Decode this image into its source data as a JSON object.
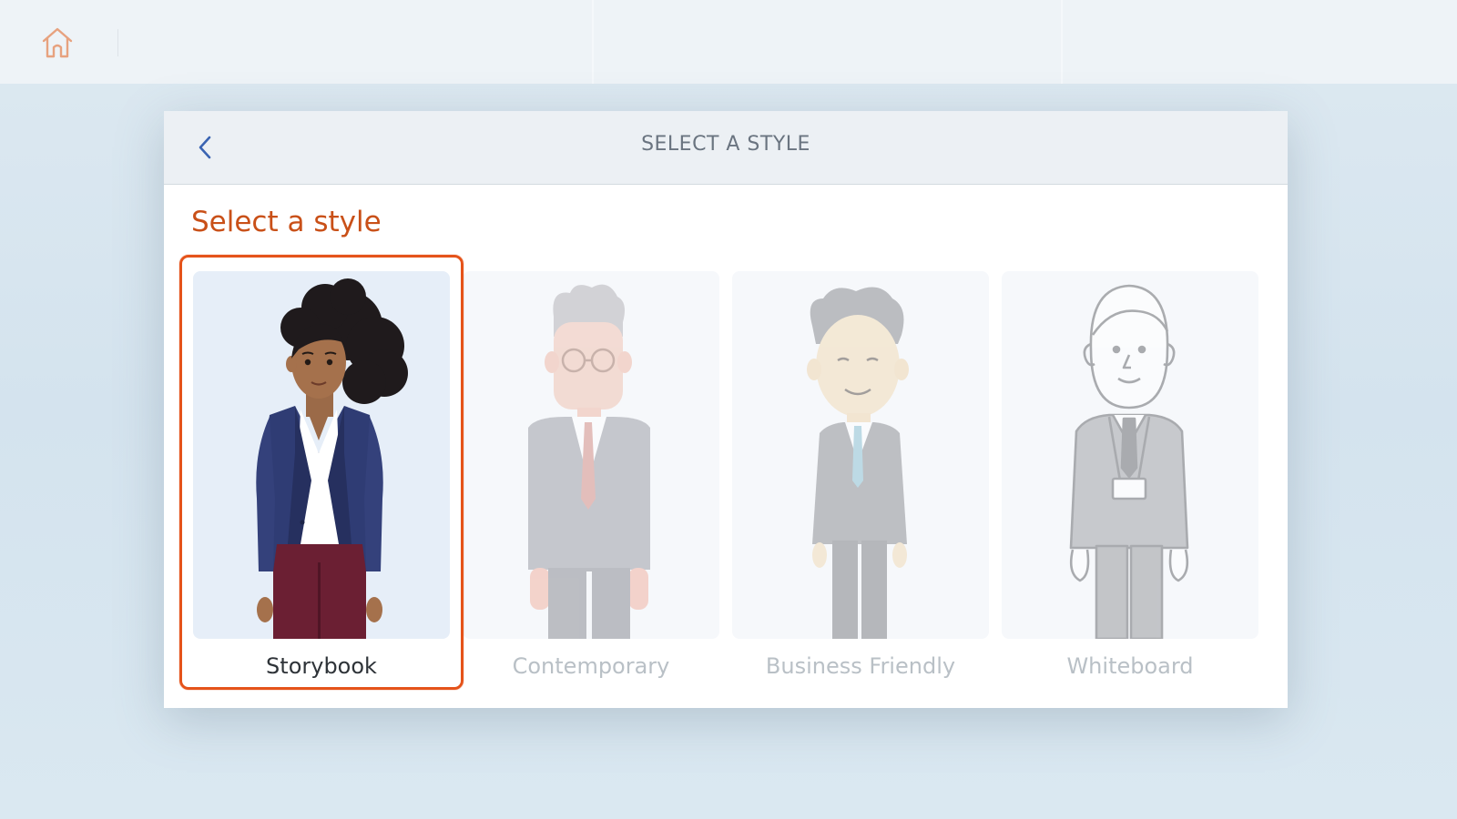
{
  "topbar": {
    "home_icon": "home-icon"
  },
  "modal": {
    "header_title": "SELECT A STYLE",
    "back_icon": "chevron-left-icon",
    "section_title": "Select a style"
  },
  "styles": [
    {
      "label": "Storybook",
      "selected": true
    },
    {
      "label": "Contemporary",
      "selected": false
    },
    {
      "label": "Business Friendly",
      "selected": false
    },
    {
      "label": "Whiteboard",
      "selected": false
    }
  ],
  "colors": {
    "accent": "#e5531a",
    "section_title": "#c95018",
    "header_bg": "#ecf0f4"
  }
}
